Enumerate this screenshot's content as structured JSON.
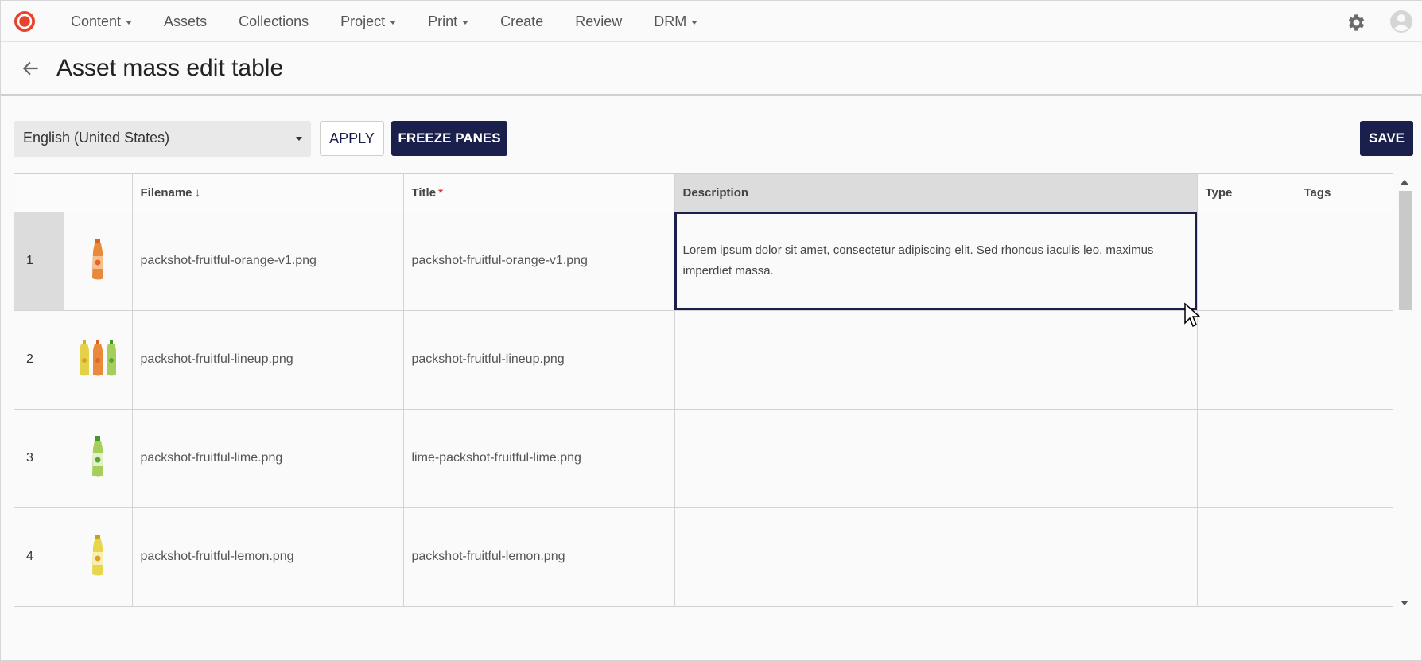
{
  "nav": {
    "items": [
      {
        "label": "Content",
        "dropdown": true
      },
      {
        "label": "Assets",
        "dropdown": false
      },
      {
        "label": "Collections",
        "dropdown": false
      },
      {
        "label": "Project",
        "dropdown": true
      },
      {
        "label": "Print",
        "dropdown": true
      },
      {
        "label": "Create",
        "dropdown": false
      },
      {
        "label": "Review",
        "dropdown": false
      },
      {
        "label": "DRM",
        "dropdown": true
      }
    ]
  },
  "page": {
    "title": "Asset mass edit table"
  },
  "toolbar": {
    "language_value": "English (United States)",
    "apply_label": "APPLY",
    "freeze_label": "FREEZE PANES",
    "save_label": "SAVE"
  },
  "table": {
    "columns": {
      "filename": "Filename",
      "filename_sort": "↓",
      "title": "Title",
      "title_required": "*",
      "description": "Description",
      "type": "Type",
      "tags": "Tags"
    },
    "rows": [
      {
        "num": "1",
        "thumb": "orange-bottle",
        "filename": "packshot-fruitful-orange-v1.png",
        "title": "packshot-fruitful-orange-v1.png",
        "description": "Lorem ipsum dolor sit amet, consectetur adipiscing elit. Sed rhoncus iaculis leo, maximus imperdiet massa.",
        "type": "",
        "tags": ""
      },
      {
        "num": "2",
        "thumb": "lineup-bottles",
        "filename": "packshot-fruitful-lineup.png",
        "title": "packshot-fruitful-lineup.png",
        "description": "",
        "type": "",
        "tags": ""
      },
      {
        "num": "3",
        "thumb": "lime-bottle",
        "filename": "packshot-fruitful-lime.png",
        "title": "lime-packshot-fruitful-lime.png",
        "description": "",
        "type": "",
        "tags": ""
      },
      {
        "num": "4",
        "thumb": "lemon-bottle",
        "filename": "packshot-fruitful-lemon.png",
        "title": "packshot-fruitful-lemon.png",
        "description": "",
        "type": "",
        "tags": ""
      }
    ]
  },
  "colors": {
    "accent": "#1b1f4b",
    "brand_red": "#e8412c",
    "required": "#d83b2f",
    "orange_bottle": "#e07b2a",
    "lime_bottle": "#8bc34a",
    "lemon_bottle": "#e8d64a"
  }
}
